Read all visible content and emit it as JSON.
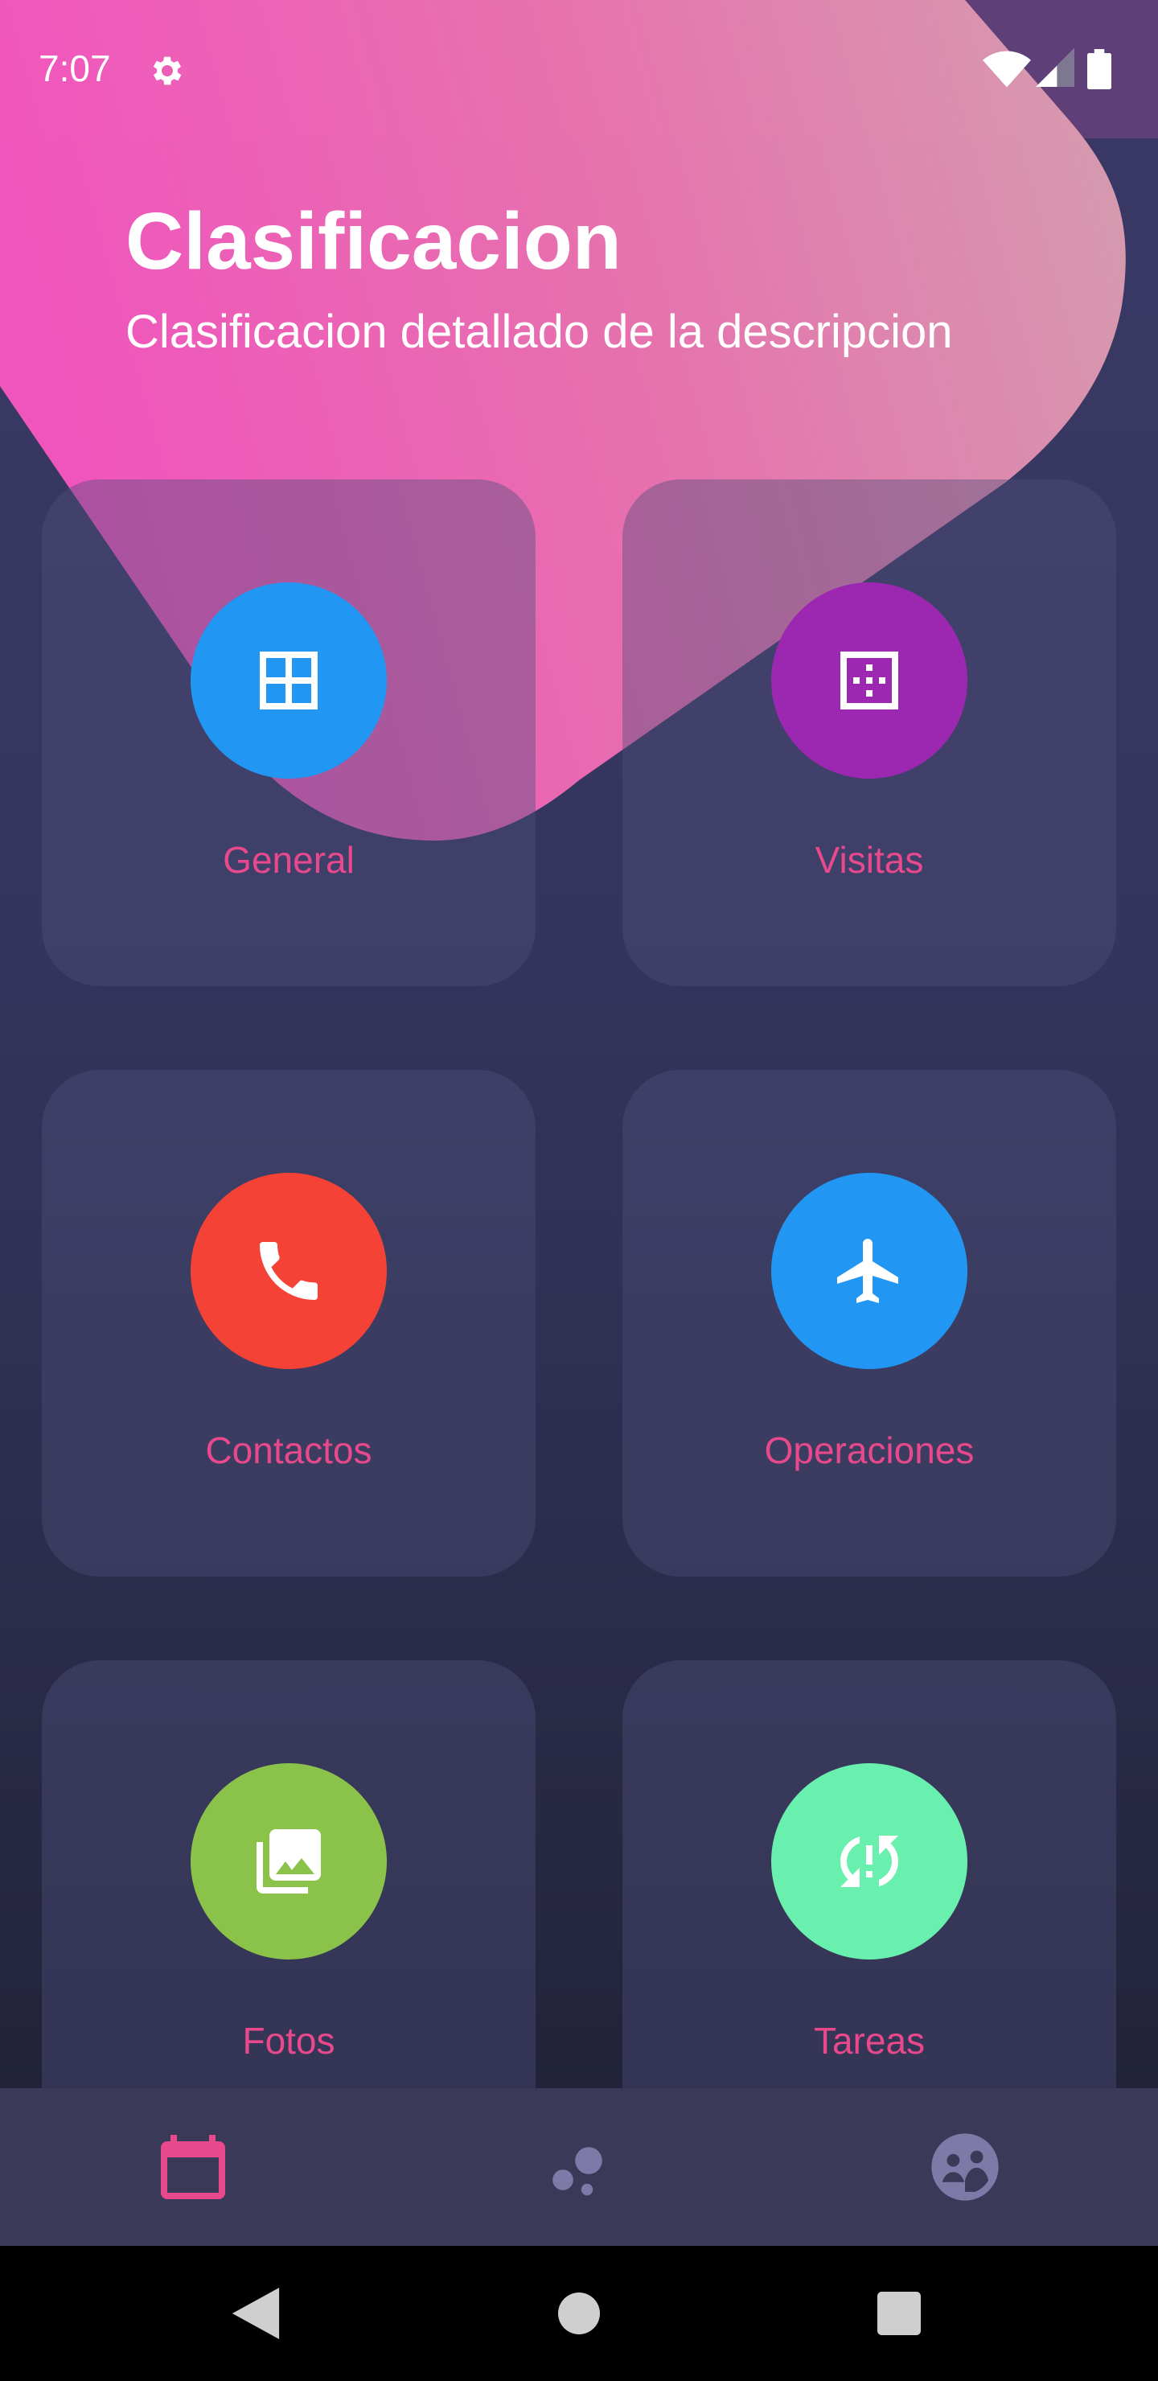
{
  "status_bar": {
    "time": "7:07"
  },
  "header": {
    "title": "Clasificacion",
    "subtitle": "Clasificacion detallado de la descripcion"
  },
  "cards": [
    {
      "label": "General",
      "icon": "grid-icon",
      "color": "#2196f3"
    },
    {
      "label": "Visitas",
      "icon": "dotted-square-icon",
      "color": "#9c27b0"
    },
    {
      "label": "Contactos",
      "icon": "phone-icon",
      "color": "#f44336"
    },
    {
      "label": "Operaciones",
      "icon": "airplane-icon",
      "color": "#2196f3"
    },
    {
      "label": "Fotos",
      "icon": "photo-library-icon",
      "color": "#8bc34a"
    },
    {
      "label": "Tareas",
      "icon": "sync-problem-icon",
      "color": "#69f0ae"
    }
  ],
  "bottom_nav": [
    {
      "icon": "calendar-icon",
      "active": true
    },
    {
      "icon": "bubbles-icon",
      "active": false
    },
    {
      "icon": "group-icon",
      "active": false
    }
  ],
  "colors": {
    "accent": "#e8498c",
    "blob_pink": "#f655c0"
  }
}
